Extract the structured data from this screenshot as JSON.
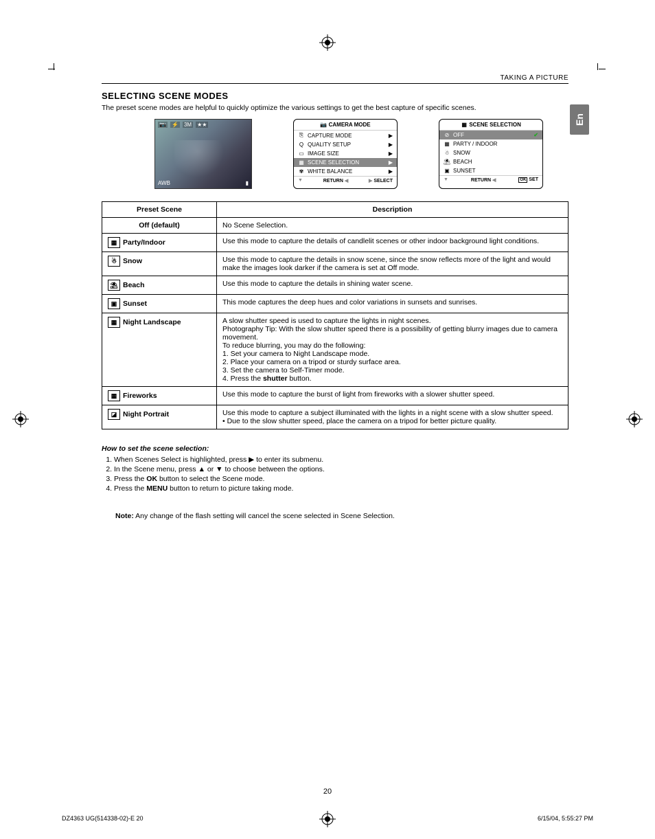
{
  "header": {
    "breadcrumb": "TAKING A PICTURE"
  },
  "lang_tab": "En",
  "section": {
    "title": "SELECTING SCENE MODES",
    "intro": "The preset scene modes are helpful to quickly optimize the various settings to get the best capture of specific scenes."
  },
  "lcd_osd": {
    "top": [
      "📷",
      "⚡",
      "3M",
      "★★"
    ],
    "bottom_left": "AWB",
    "bottom_right": ""
  },
  "menu1": {
    "title": "CAMERA MODE",
    "items": [
      {
        "icon": "⎘",
        "label": "CAPTURE MODE",
        "arrow": "▶"
      },
      {
        "icon": "Q",
        "label": "QUALITY SETUP",
        "arrow": "▶"
      },
      {
        "icon": "▭",
        "label": "IMAGE SIZE",
        "arrow": "▶"
      },
      {
        "icon": "▦",
        "label": "SCENE SELECTION",
        "arrow": "▶",
        "highlight": true
      },
      {
        "icon": "✾",
        "label": "WHITE BALANCE",
        "arrow": "▶"
      }
    ],
    "footer": {
      "left": "RETURN",
      "left_tri": "◀",
      "right_tri": "▶",
      "right": "SELECT",
      "down": "▼"
    }
  },
  "menu2": {
    "title": "SCENE  SELECTION",
    "items": [
      {
        "icon": "⊘",
        "label": "OFF",
        "check": true,
        "highlight": true
      },
      {
        "icon": "▦",
        "label": "PARTY / INDOOR"
      },
      {
        "icon": "☃",
        "label": "SNOW"
      },
      {
        "icon": "⛱",
        "label": "BEACH"
      },
      {
        "icon": "▣",
        "label": "SUNSET"
      }
    ],
    "footer": {
      "left": "RETURN",
      "left_tri": "◀",
      "ok": "OK",
      "right": "SET",
      "down": "▼"
    }
  },
  "table": {
    "headers": {
      "scene": "Preset Scene",
      "desc": "Description"
    },
    "rows": [
      {
        "scene": "Off (default)",
        "icon": "",
        "desc": "No Scene Selection."
      },
      {
        "scene": "Party/Indoor",
        "icon": "▦",
        "desc": "Use this mode to capture the details of candlelit scenes or other indoor background light conditions."
      },
      {
        "scene": "Snow",
        "icon": "☃",
        "desc": "Use this mode to capture the details in snow scene, since the snow reflects more of the light and would make the images look darker if the camera is set at Off mode."
      },
      {
        "scene": "Beach",
        "icon": "⛱",
        "desc": "Use this mode to capture the details in shining water scene."
      },
      {
        "scene": "Sunset",
        "icon": "▣",
        "desc": "This mode captures the deep hues and color variations in sunsets and sunrises."
      },
      {
        "scene": "Night Landscape",
        "icon": "▦",
        "desc": "A slow shutter speed is used to capture the lights in night scenes.\nPhotography Tip: With the slow shutter speed there is a possibility of getting blurry  images due to camera movement.\nTo reduce blurring, you may do the following:\n1. Set your camera to Night Landscape mode.\n2. Place your camera on a tripod or sturdy surface area.\n3. Set the camera to Self-Timer mode.\n4. Press the shutter button."
      },
      {
        "scene": "Fireworks",
        "icon": "▦",
        "desc": "Use this mode to capture the burst of light from fireworks with a slower shutter speed."
      },
      {
        "scene": "Night Portrait",
        "icon": "◪",
        "desc": "Use this mode to capture a subject illuminated with the lights in a night scene with a slow shutter speed.\n•  Due to the slow shutter speed, place the camera on a tripod for better picture quality."
      }
    ]
  },
  "howto": {
    "title": "How to set the scene selection:",
    "steps": [
      "When Scenes Select is highlighted, press  ▶  to enter its submenu.",
      "In the Scene menu, press  ▲  or  ▼  to choose between the options.",
      "Press the OK button to select the Scene mode.",
      "Press the MENU button to return to picture taking mode."
    ],
    "step3_bold": "OK",
    "step4_bold": "MENU"
  },
  "note": {
    "prefix": "Note:",
    "text": " Any change of the flash setting will cancel the scene selected in Scene Selection."
  },
  "page_number": "20",
  "footer": {
    "left": "DZ4363 UG(514338-02)-E   20",
    "right": "6/15/04, 5:55:27 PM"
  }
}
